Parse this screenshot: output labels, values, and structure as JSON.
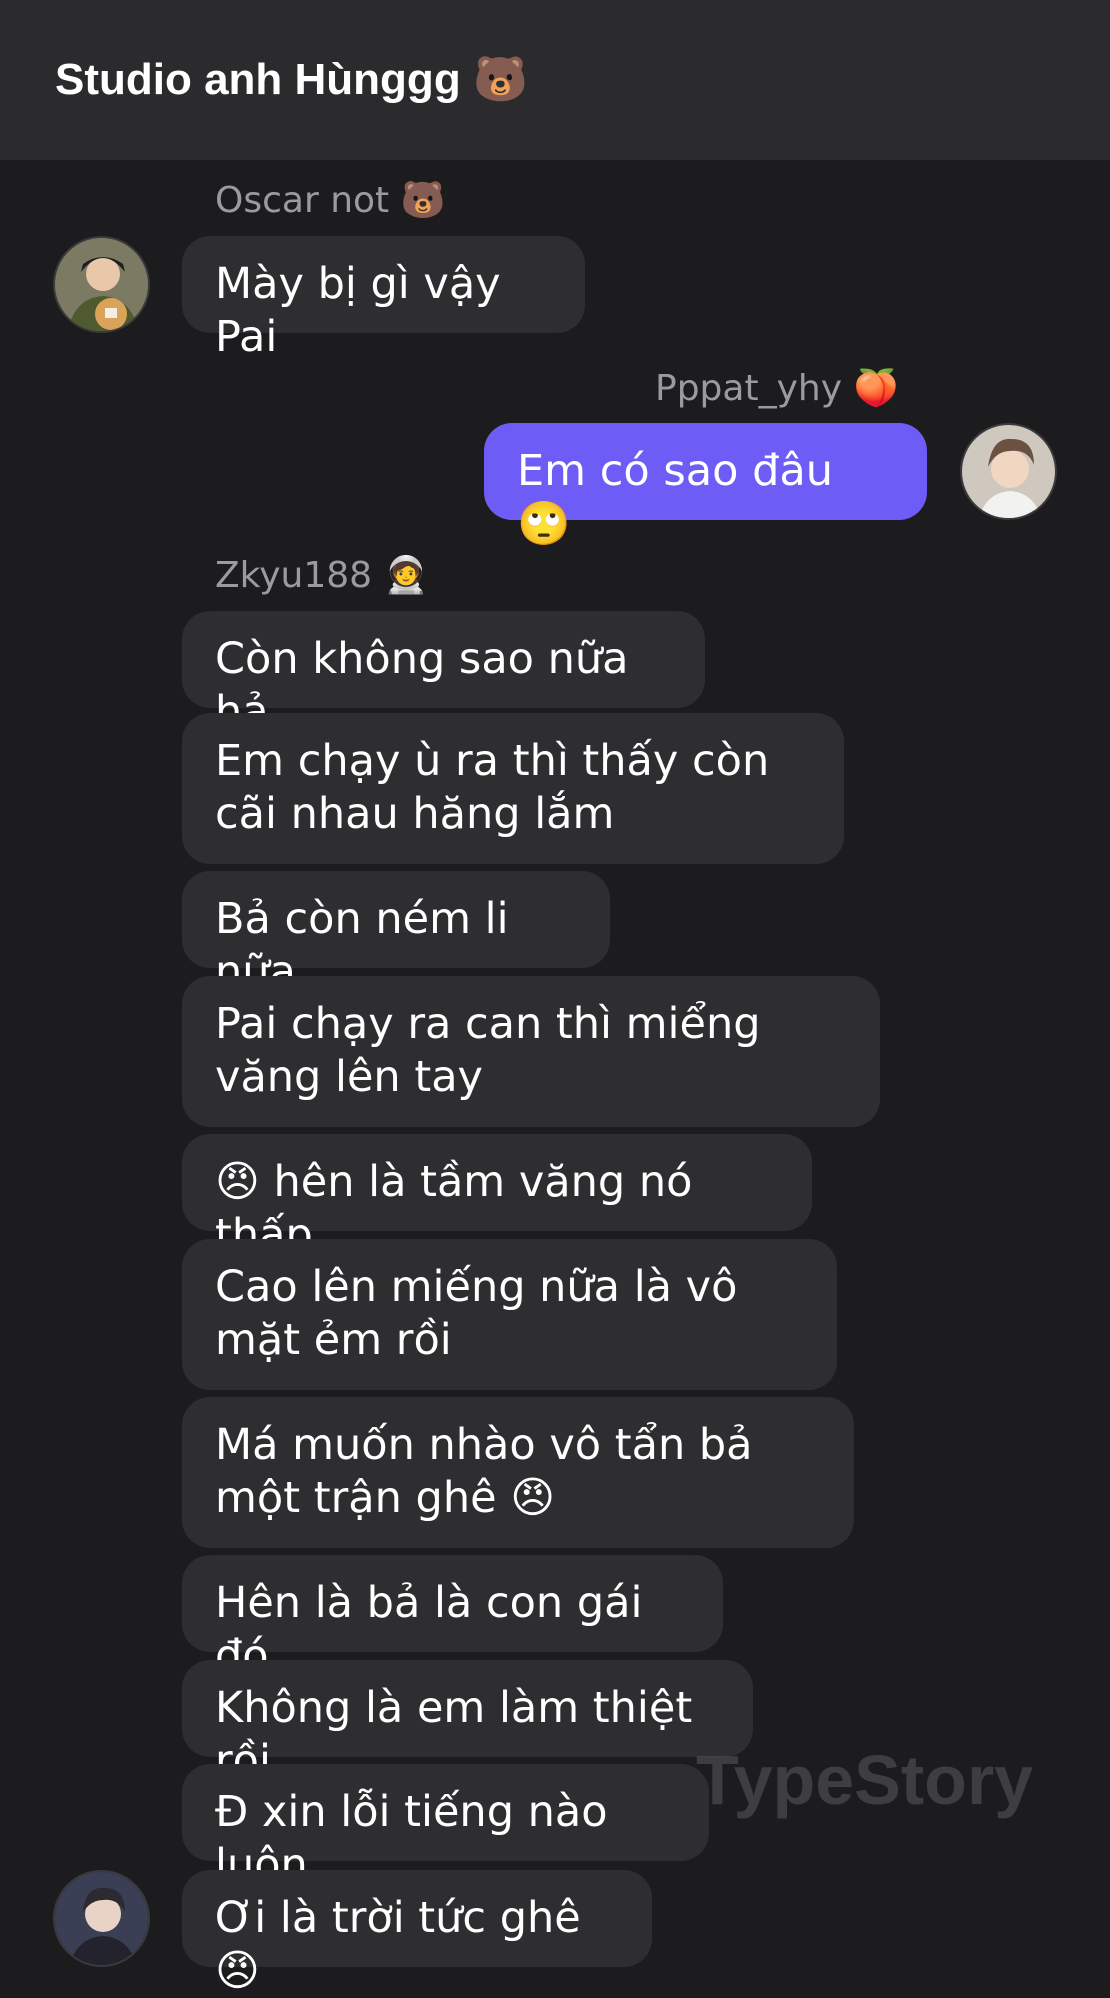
{
  "header": {
    "title": "Studio anh Hùnggg",
    "title_emoji": "🐻"
  },
  "messages": {
    "m1": {
      "sender": "Oscar not",
      "sender_emoji": "🐻",
      "text": "Mày bị gì vậy Pai",
      "avatar": "avatar-oscar"
    },
    "m2": {
      "sender": "Pppat_yhy",
      "sender_emoji": "🍑",
      "text": "Em có sao đâu",
      "text_emoji": "🙄",
      "avatar": "avatar-pppat"
    },
    "m3": {
      "sender": "Zkyu188",
      "sender_emoji": "🧑‍🚀",
      "avatar": "avatar-zkyu"
    },
    "zkyu_lines": [
      "Còn không sao nữa hả",
      "Em chạy ù ra thì thấy còn cãi nhau hăng lắm",
      "Bả còn ném li nữa",
      "Pai chạy ra can thì miểng văng lên tay",
      "hên là tầm văng nó thấp",
      "Cao lên miếng nữa là vô mặt ẻm rồi",
      "Má muốn nhào vô tẩn bả một trận ghê",
      "Hên là bả là con gái đó",
      "Không là em làm thiệt rồi",
      "Đ xin lỗi tiếng nào luôn",
      "Ơi là trời tức ghê"
    ],
    "emojis": {
      "angry": "😠"
    }
  },
  "watermark": "TypeStory",
  "colors": {
    "background": "#1c1c1e",
    "header": "#2b2b2d",
    "bubble_in": "#2e2e31",
    "bubble_out": "#6d5df6",
    "sender_name": "#9a9a9f"
  }
}
